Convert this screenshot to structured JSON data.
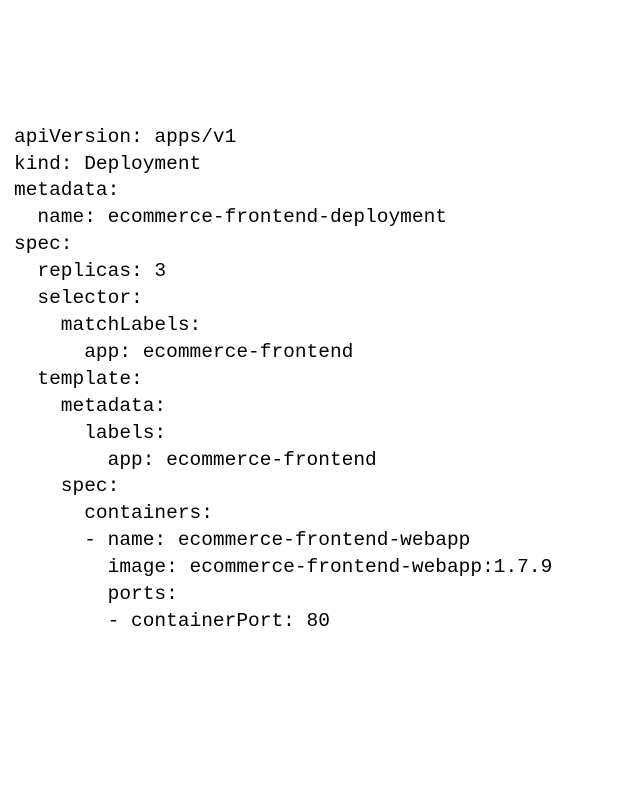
{
  "lines": [
    "apiVersion: apps/v1",
    "kind: Deployment",
    "metadata:",
    "  name: ecommerce-frontend-deployment",
    "spec:",
    "  replicas: 3",
    "  selector:",
    "    matchLabels:",
    "      app: ecommerce-frontend",
    "  template:",
    "    metadata:",
    "      labels:",
    "        app: ecommerce-frontend",
    "    spec:",
    "      containers:",
    "      - name: ecommerce-frontend-webapp",
    "        image: ecommerce-frontend-webapp:1.7.9",
    "        ports:",
    "        - containerPort: 80"
  ]
}
